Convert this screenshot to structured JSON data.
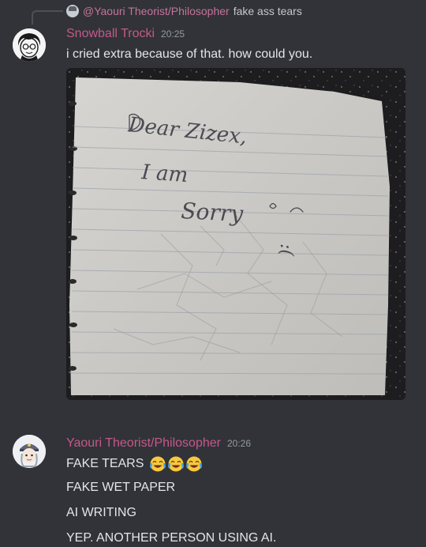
{
  "reply": {
    "author": "@Yaouri Theorist/Philosopher",
    "text": "fake ass tears"
  },
  "messages": [
    {
      "author": "Snowball Trocki",
      "time": "20:25",
      "lines": [
        "i cried extra because of that. how could you."
      ],
      "attachment": {
        "handwriting": [
          "Dear Zizex,",
          "I am",
          "Sorry",
          ":("
        ]
      }
    },
    {
      "author": "Yaouri Theorist/Philosopher",
      "time": "20:26",
      "lines": [
        "FAKE TEARS",
        "FAKE WET PAPER",
        "AI WRITING",
        "YEP. ANOTHER PERSON USING AI."
      ],
      "emoji": [
        "face-with-tears-of-joy-icon",
        "face-with-tears-of-joy-icon",
        "face-with-tears-of-joy-icon"
      ]
    }
  ],
  "colors": {
    "background": "#313338",
    "author_name": "#c6588a",
    "timestamp": "#949ba4",
    "text": "#e3e5e8"
  }
}
